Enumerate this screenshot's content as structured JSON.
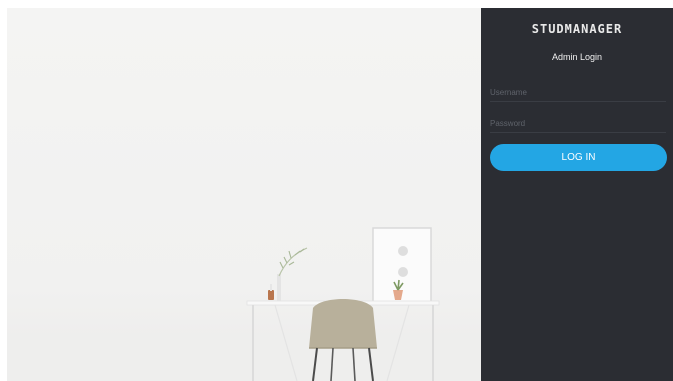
{
  "brand": {
    "logo_text": "studmanager"
  },
  "login": {
    "title": "Admin Login",
    "username_placeholder": "Username",
    "password_placeholder": "Password",
    "button_label": "LOG IN"
  },
  "colors": {
    "panel_bg": "#2b2d33",
    "button_bg": "#23a6e4",
    "hero_bg": "#f3f3f2"
  }
}
